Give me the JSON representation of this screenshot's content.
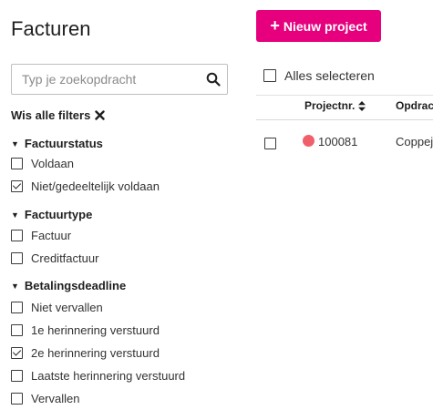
{
  "header": {
    "title": "Facturen",
    "new_project_label": "Nieuw project"
  },
  "search": {
    "placeholder": "Typ je zoekopdracht",
    "value": ""
  },
  "filters": {
    "clear_label": "Wis alle filters",
    "groups": [
      {
        "title": "Factuurstatus",
        "options": [
          {
            "label": "Voldaan",
            "checked": false
          },
          {
            "label": "Niet/gedeeltelijk voldaan",
            "checked": true
          }
        ]
      },
      {
        "title": "Factuurtype",
        "options": [
          {
            "label": "Factuur",
            "checked": false
          },
          {
            "label": "Creditfactuur",
            "checked": false
          }
        ]
      },
      {
        "title": "Betalingsdeadline",
        "options": [
          {
            "label": "Niet vervallen",
            "checked": false
          },
          {
            "label": "1e herinnering verstuurd",
            "checked": false
          },
          {
            "label": "2e herinnering verstuurd",
            "checked": true
          },
          {
            "label": "Laatste herinnering verstuurd",
            "checked": false
          },
          {
            "label": "Vervallen",
            "checked": false
          }
        ]
      }
    ]
  },
  "table": {
    "select_all_label": "Alles selecteren",
    "columns": [
      "Projectnr.",
      "Opdrac"
    ],
    "rows": [
      {
        "status_color": "#f0606a",
        "projectnr": "100081",
        "client": "Coppej",
        "checked": false
      }
    ]
  }
}
